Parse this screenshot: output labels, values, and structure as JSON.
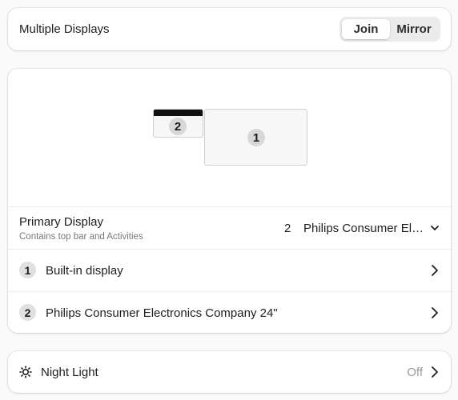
{
  "multiple_displays": {
    "label": "Multiple Displays",
    "options": [
      "Join",
      "Mirror"
    ],
    "selected": "Join"
  },
  "arrangement": {
    "monitors": [
      {
        "number": "2"
      },
      {
        "number": "1"
      }
    ]
  },
  "primary_display": {
    "title": "Primary Display",
    "subtitle": "Contains top bar and Activities",
    "selected_number": "2",
    "selected_name": "Philips Consumer El…"
  },
  "displays": [
    {
      "number": "1",
      "name": "Built-in display"
    },
    {
      "number": "2",
      "name": "Philips Consumer Electronics Company 24\""
    }
  ],
  "night_light": {
    "label": "Night Light",
    "status": "Off"
  },
  "icons": {
    "chevron_down": "chevron-down-icon",
    "chevron_right": "chevron-right-icon",
    "night_light": "sun-icon"
  }
}
